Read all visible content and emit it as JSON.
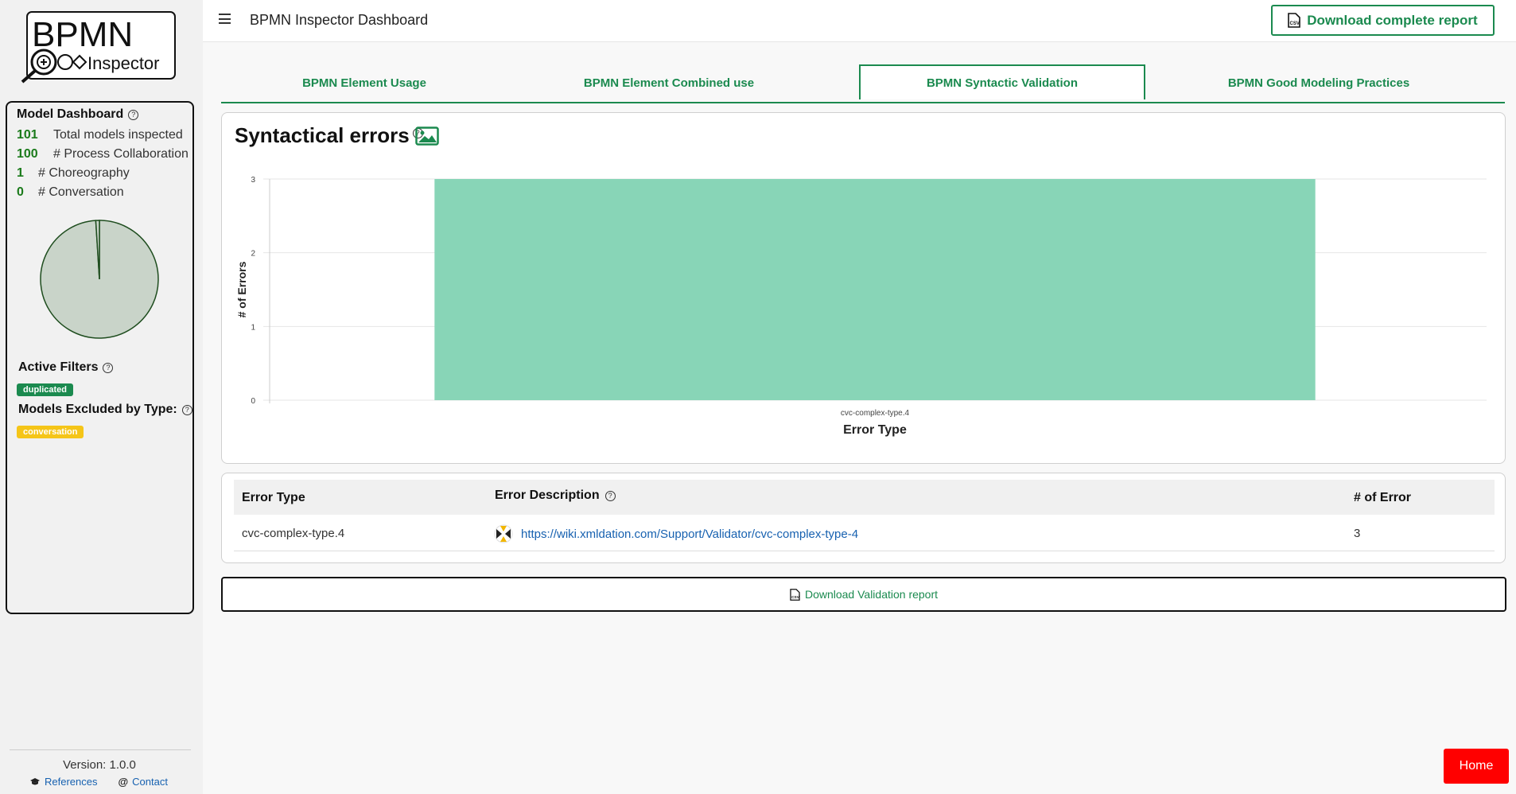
{
  "logo": {
    "line1": "BPMN",
    "line2": "Inspector"
  },
  "sidebar": {
    "dashboard_title": "Model Dashboard",
    "stats": [
      {
        "num": "101",
        "label": "Total models inspected"
      },
      {
        "num": "100",
        "label": "# Process Collaboration"
      },
      {
        "num": "1",
        "label": "# Choreography"
      },
      {
        "num": "0",
        "label": "# Conversation"
      }
    ],
    "pie": {
      "slices": [
        {
          "label": "Process Collaboration",
          "value": 100
        },
        {
          "label": "Choreography",
          "value": 1
        }
      ]
    },
    "active_filters_title": "Active Filters",
    "active_filter_badge": "duplicated",
    "excluded_title": "Models Excluded by Type:",
    "excluded_badge": "conversation",
    "version": "Version: 1.0.0",
    "links": {
      "references": "References",
      "contact": "Contact"
    }
  },
  "header": {
    "title": "BPMN Inspector Dashboard",
    "download_label": "Download complete report"
  },
  "tabs": [
    {
      "label": "BPMN Element Usage",
      "active": false
    },
    {
      "label": "BPMN Element Combined use",
      "active": false
    },
    {
      "label": "BPMN Syntactic Validation",
      "active": true
    },
    {
      "label": "BPMN Good Modeling Practices",
      "active": false
    }
  ],
  "chart_card": {
    "title": "Syntactical errors"
  },
  "chart_data": {
    "type": "bar",
    "categories": [
      "cvc-complex-type.4"
    ],
    "values": [
      3
    ],
    "title": "Syntactical errors",
    "xlabel": "Error Type",
    "ylabel": "# of Errors",
    "ylim": [
      0,
      3
    ],
    "yticks": [
      "0",
      "1",
      "2",
      "3"
    ],
    "grid": true,
    "bar_color": "#88d5b7"
  },
  "table": {
    "headers": {
      "type": "Error Type",
      "description": "Error Description",
      "count": "# of Error"
    },
    "rows": [
      {
        "type": "cvc-complex-type.4",
        "description": "https://wiki.xmldation.com/Support/Validator/cvc-complex-type-4",
        "count": "3"
      }
    ]
  },
  "download_validation_label": "Download Validation report",
  "home_label": "Home",
  "colors": {
    "accent": "#1b8a4f",
    "home": "#ff0000",
    "badge_yellow": "#f5c518"
  }
}
